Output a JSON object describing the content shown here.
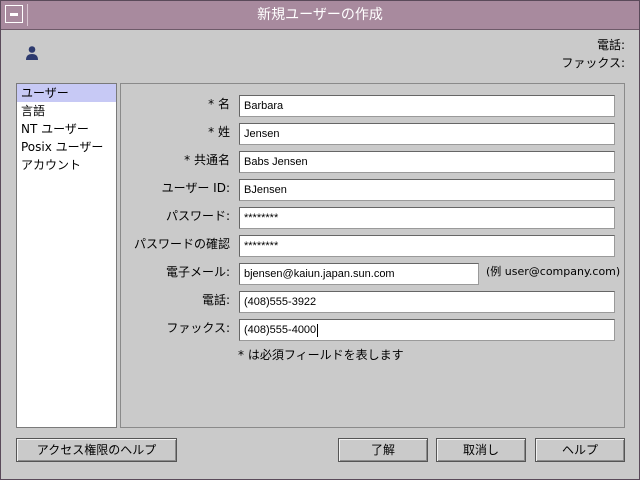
{
  "window": {
    "title": "新規ユーザーの作成"
  },
  "header": {
    "phone_label": "電話:",
    "fax_label": "ファックス:"
  },
  "sidebar": {
    "items": [
      {
        "label": "ユーザー",
        "selected": true
      },
      {
        "label": "言語",
        "selected": false
      },
      {
        "label": "NT ユーザー",
        "selected": false
      },
      {
        "label": "Posix ユーザー",
        "selected": false
      },
      {
        "label": "アカウント",
        "selected": false
      }
    ]
  },
  "form": {
    "fields": [
      {
        "label": "* 名",
        "value": "Barbara"
      },
      {
        "label": "* 姓",
        "value": "Jensen"
      },
      {
        "label": "* 共通名",
        "value": "Babs Jensen"
      },
      {
        "label": "ユーザー ID:",
        "value": "BJensen"
      },
      {
        "label": "パスワード:",
        "value": "********"
      },
      {
        "label": "パスワードの確認",
        "value": "********"
      },
      {
        "label": "電子メール:",
        "value": "bjensen@kaiun.japan.sun.com"
      },
      {
        "label": "電話:",
        "value": "(408)555-3922"
      },
      {
        "label": "ファックス:",
        "value": "(408)555-4000"
      }
    ],
    "email_example": "(例 user@company.com)",
    "required_note": "* は必須フィールドを表します"
  },
  "buttons": {
    "access_help": "アクセス権限のヘルプ",
    "ok": "了解",
    "cancel": "取消し",
    "help": "ヘルプ"
  },
  "colors": {
    "titlebar": "#a88a9e",
    "selected_item": "#c7c9f5",
    "background": "#cacaca"
  }
}
